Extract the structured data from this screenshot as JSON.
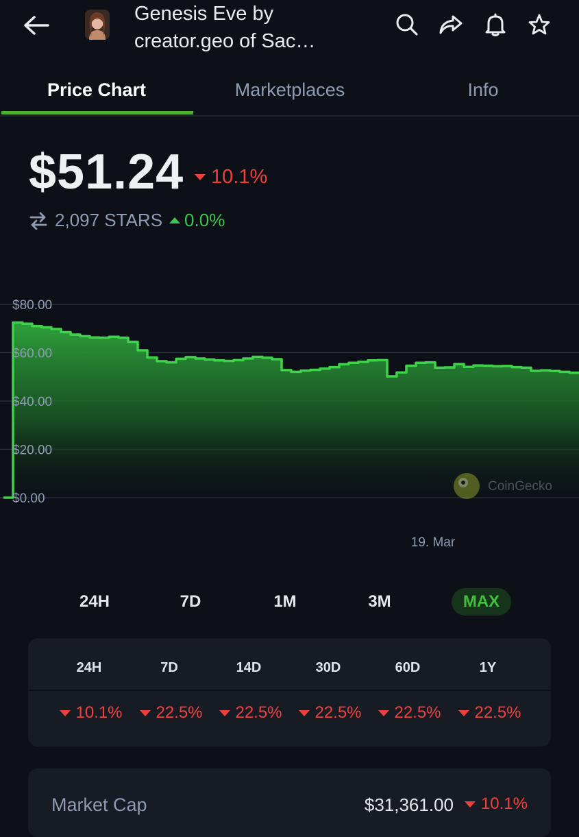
{
  "header": {
    "title_line1": "Genesis Eve by",
    "title_line2": "creator.geo of Sac…"
  },
  "tabs": [
    {
      "label": "Price Chart",
      "active": true
    },
    {
      "label": "Marketplaces",
      "active": false
    },
    {
      "label": "Info",
      "active": false
    }
  ],
  "price": {
    "value": "$51.24",
    "change": "10.1%",
    "change_direction": "down",
    "stars_value": "2,097 STARS",
    "stars_change": "0.0%",
    "stars_direction": "up"
  },
  "chart_data": {
    "type": "area",
    "y_ticks": [
      "$80.00",
      "$60.00",
      "$40.00",
      "$20.00",
      "$0.00"
    ],
    "ylim": [
      0,
      80
    ],
    "x_tick": "19. Mar",
    "watermark": "CoinGecko",
    "line_color": "#3fd24a",
    "values": [
      0,
      72.5,
      72.0,
      71.0,
      70.5,
      69.8,
      68.5,
      67.5,
      66.8,
      66.3,
      66.2,
      66.6,
      66.2,
      64.5,
      61.0,
      58.0,
      56.5,
      56.0,
      57.5,
      58.2,
      57.6,
      57.2,
      56.8,
      56.6,
      56.9,
      57.6,
      58.3,
      57.9,
      57.3,
      52.8,
      52.1,
      52.6,
      52.9,
      53.4,
      54.0,
      55.2,
      55.8,
      56.2,
      56.8,
      56.9,
      50.2,
      51.8,
      54.6,
      55.8,
      56.0,
      53.8,
      53.9,
      55.3,
      54.1,
      54.7,
      54.6,
      54.4,
      54.5,
      54.0,
      53.8,
      52.5,
      52.7,
      52.4,
      52.1,
      51.7,
      51.24
    ]
  },
  "ranges": [
    {
      "label": "24H",
      "active": false
    },
    {
      "label": "7D",
      "active": false
    },
    {
      "label": "1M",
      "active": false
    },
    {
      "label": "3M",
      "active": false
    },
    {
      "label": "MAX",
      "active": true
    }
  ],
  "changes": {
    "headers": [
      "24H",
      "7D",
      "14D",
      "30D",
      "60D",
      "1Y"
    ],
    "values": [
      "10.1%",
      "22.5%",
      "22.5%",
      "22.5%",
      "22.5%",
      "22.5%"
    ]
  },
  "market_cap": {
    "label": "Market Cap",
    "value": "$31,361.00",
    "change": "10.1%"
  },
  "colors": {
    "accent": "#4cb02c",
    "negative": "#f0403e",
    "positive": "#3ec44f",
    "background": "#0d1117"
  }
}
